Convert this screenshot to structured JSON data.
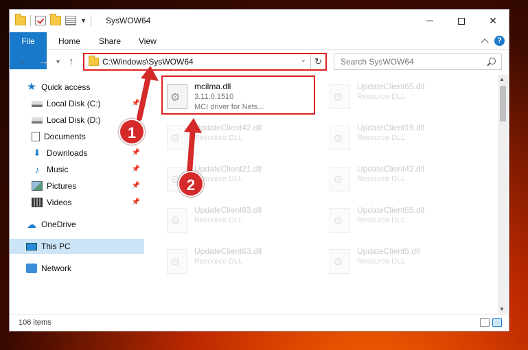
{
  "window": {
    "title": "SysWOW64"
  },
  "ribbon": {
    "tabs": [
      "File",
      "Home",
      "Share",
      "View"
    ],
    "help": "?"
  },
  "address": {
    "path": "C:\\Windows\\SysWOW64",
    "refresh_icon": "refresh-icon"
  },
  "search": {
    "placeholder": "Search SysWOW64"
  },
  "sidebar": {
    "items": [
      {
        "label": "Quick access",
        "icon": "star-icon"
      },
      {
        "label": "Local Disk (C:)",
        "icon": "disk-icon"
      },
      {
        "label": "Local Disk (D:)",
        "icon": "disk-icon"
      },
      {
        "label": "Documents",
        "icon": "documents-icon"
      },
      {
        "label": "Downloads",
        "icon": "downloads-icon"
      },
      {
        "label": "Music",
        "icon": "music-icon"
      },
      {
        "label": "Pictures",
        "icon": "pictures-icon"
      },
      {
        "label": "Videos",
        "icon": "videos-icon"
      },
      {
        "label": "OneDrive",
        "icon": "onedrive-icon"
      },
      {
        "label": "This PC",
        "icon": "pc-icon"
      },
      {
        "label": "Network",
        "icon": "network-icon"
      }
    ]
  },
  "files": [
    {
      "name": "mcilma.dll",
      "version": "3.11.0.1510",
      "description": "MCI driver for Nets..."
    },
    {
      "name": "UpdateClient65.dll",
      "description": "Resource DLL"
    },
    {
      "name": "UpdateClient42.dll",
      "description": "Resource DLL"
    },
    {
      "name": "UpdateClient19.dll",
      "description": "Resource DLL"
    },
    {
      "name": "UpdateClient21.dll",
      "description": "Resource DLL"
    },
    {
      "name": "UpdateClient42.dll",
      "description": "Resource DLL"
    },
    {
      "name": "UpdateClient63.dll",
      "description": "Resource DLL"
    },
    {
      "name": "UpdateClient65.dll",
      "description": "Resource DLL"
    },
    {
      "name": "UpdateClient63.dll",
      "description": "Resource DLL"
    },
    {
      "name": "UpdateClient5.dll",
      "description": "Resource DLL"
    }
  ],
  "status": {
    "count": "106 items"
  },
  "annotations": {
    "step1": "1",
    "step2": "2"
  },
  "colors": {
    "accent": "#1979ca",
    "highlight": "#e02020",
    "selected": "#cce4f7"
  }
}
